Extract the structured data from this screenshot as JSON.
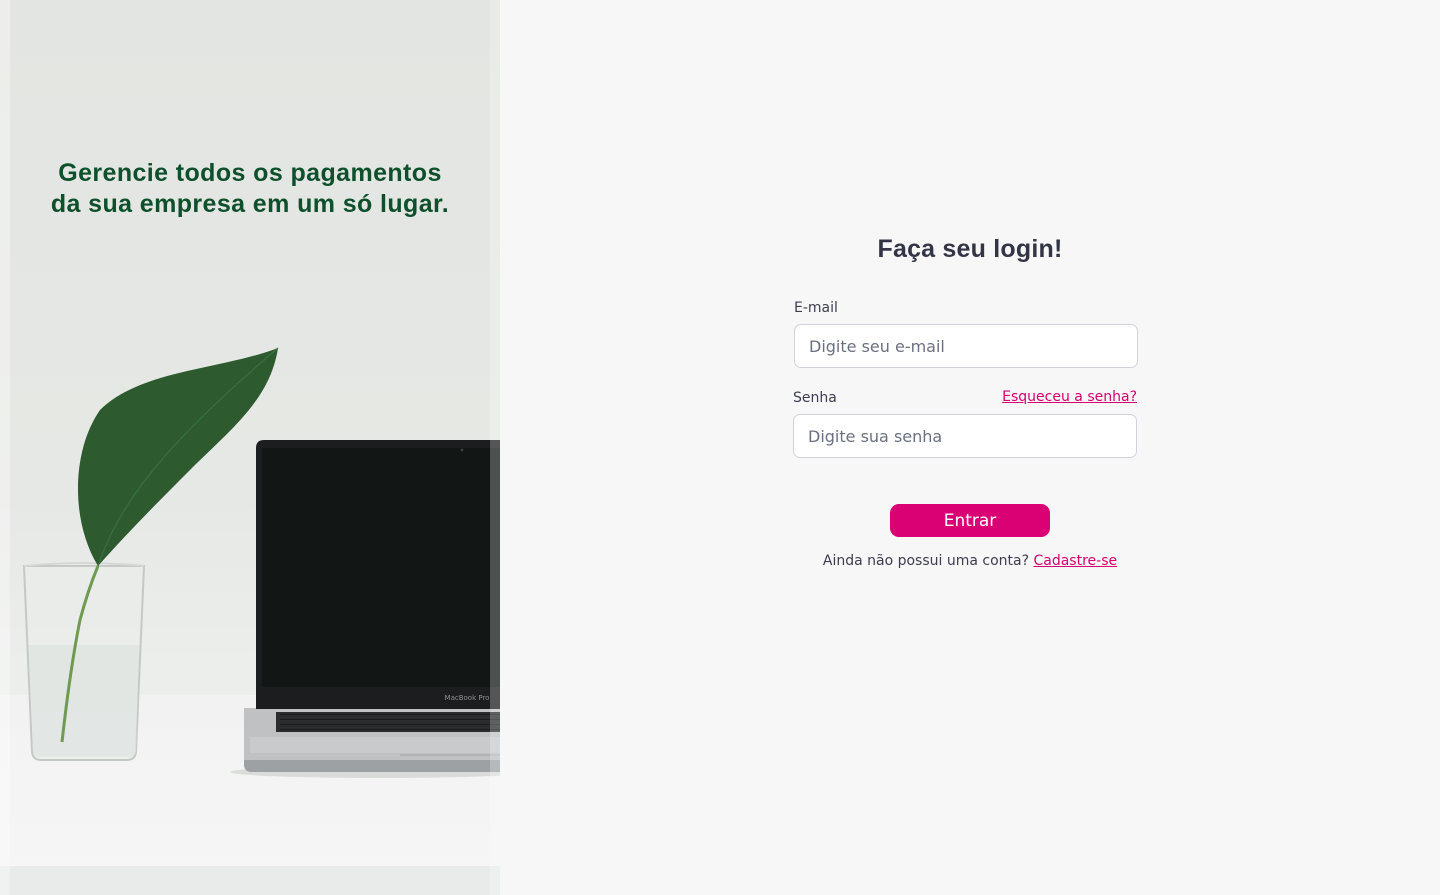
{
  "hero": {
    "headline": "Gerencie todos os pagamentos da sua empresa em um só lugar.",
    "laptop_brand_text": "MacBook Pro"
  },
  "login": {
    "title": "Faça seu login!",
    "email": {
      "label": "E-mail",
      "placeholder": "Digite seu e-mail",
      "value": ""
    },
    "password": {
      "label": "Senha",
      "placeholder": "Digite sua senha",
      "value": ""
    },
    "forgot_link": "Esqueceu a senha?",
    "submit_label": "Entrar",
    "signup_prompt": "Ainda não possui uma conta?",
    "signup_link": "Cadastre-se"
  },
  "colors": {
    "accent": "#da0175",
    "link": "#d6006f",
    "headline": "#0e4f2c",
    "title": "#343447",
    "panel_background": "#f7f7f7"
  }
}
